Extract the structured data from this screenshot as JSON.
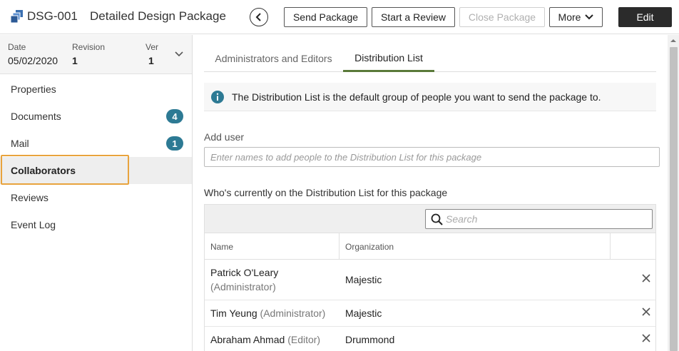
{
  "header": {
    "doc_id": "DSG-001",
    "doc_title": "Detailed Design Package",
    "send_package": "Send Package",
    "start_review": "Start a Review",
    "close_package": "Close Package",
    "more": "More",
    "edit": "Edit"
  },
  "sidebar": {
    "meta": {
      "date_label": "Date",
      "date_value": "05/02/2020",
      "revision_label": "Revision",
      "revision_value": "1",
      "ver_label": "Ver",
      "ver_value": "1"
    },
    "items": [
      {
        "label": "Properties"
      },
      {
        "label": "Documents",
        "badge": "4"
      },
      {
        "label": "Mail",
        "badge": "1"
      },
      {
        "label": "Collaborators"
      },
      {
        "label": "Reviews"
      },
      {
        "label": "Event Log"
      }
    ]
  },
  "main": {
    "tabs": [
      {
        "label": "Administrators and Editors"
      },
      {
        "label": "Distribution List"
      }
    ],
    "info_text": "The Distribution List is the default group of people you want to send the package to.",
    "add_user_label": "Add user",
    "add_user_placeholder": "Enter names to add people to the Distribution List for this package",
    "list_label": "Who's currently on the Distribution List for this package",
    "search_placeholder": "Search",
    "columns": {
      "name": "Name",
      "organization": "Organization"
    },
    "rows": [
      {
        "name": "Patrick O'Leary",
        "role": "(Administrator)",
        "org": "Majestic"
      },
      {
        "name": "Tim Yeung",
        "role": "(Administrator)",
        "org": "Majestic"
      },
      {
        "name": "Abraham Ahmad",
        "role": "(Editor)",
        "org": "Drummond"
      }
    ]
  },
  "colors": {
    "accent_badge": "#2d7a94",
    "tab_underline": "#5a7a3a",
    "highlight": "#e8a33d",
    "edit_button": "#2b2b2b"
  },
  "icons": {
    "logo": "package-icon",
    "back": "chevron-left-icon",
    "more": "chevron-down-icon",
    "info": "info-icon",
    "search": "search-icon",
    "remove": "close-icon"
  }
}
